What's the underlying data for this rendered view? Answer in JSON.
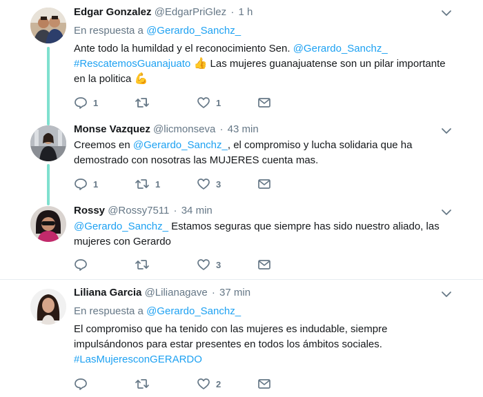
{
  "tweets": [
    {
      "name": "Edgar Gonzalez",
      "handle": "@EdgarPriGlez",
      "sep": "·",
      "time": "1 h",
      "reply_prefix": "En respuesta a",
      "reply_handle": "@Gerardo_Sanchz_",
      "text": {
        "p1": "Ante todo la humildad y el reconocimiento Sen. ",
        "mention": "@Gerardo_Sanchz_",
        "hashtag": "#RescatemosGuanajuato",
        "emoji1": "👍",
        "p2": " Las mujeres guanajuatense son un pilar importante en la politica ",
        "emoji2": "💪"
      },
      "reply_count": "1",
      "retweet_count": "",
      "like_count": "1"
    },
    {
      "name": "Monse Vazquez",
      "handle": "@licmonseva",
      "sep": "·",
      "time": "43 min",
      "text": {
        "p1": "Creemos en ",
        "mention": "@Gerardo_Sanchz_",
        "p2": ", el compromiso y lucha solidaria que ha demostrado con nosotras  las MUJERES cuenta mas."
      },
      "reply_count": "1",
      "retweet_count": "1",
      "like_count": "3"
    },
    {
      "name": "Rossy",
      "handle": "@Rossy7511",
      "sep": "·",
      "time": "34 min",
      "text": {
        "mention": "@Gerardo_Sanchz_",
        "p1": " Estamos seguras  que siempre has sido nuestro aliado,  las mujeres con Gerardo"
      },
      "reply_count": "",
      "retweet_count": "",
      "like_count": "3"
    },
    {
      "name": "Liliana Garcia",
      "handle": "@Lilianagave",
      "sep": "·",
      "time": "37 min",
      "reply_prefix": "En respuesta a",
      "reply_handle": "@Gerardo_Sanchz_",
      "text": {
        "p1": "El compromiso que ha tenido con las mujeres es indudable, siempre impulsándonos para estar presentes en todos los ámbitos sociales. ",
        "hashtag": "#LasMujeresconGERARDO"
      },
      "reply_count": "",
      "retweet_count": "",
      "like_count": "2"
    }
  ],
  "icons": {
    "reply": "reply-icon",
    "retweet": "retweet-icon",
    "like": "heart-icon",
    "dm": "envelope-icon",
    "more": "chevron-down-icon"
  },
  "colors": {
    "link": "#1da1f2",
    "muted": "#657786",
    "thread": "#7fe0cf"
  }
}
